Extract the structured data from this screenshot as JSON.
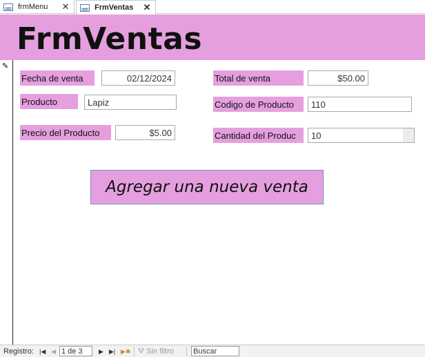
{
  "tabs": [
    {
      "label": "frmMenu",
      "close": "✕"
    },
    {
      "label": "FrmVentas",
      "close": "✕"
    }
  ],
  "form": {
    "title": "FrmVentas",
    "fields": {
      "fecha_label": "Fecha de venta",
      "fecha_value": "02/12/2024",
      "producto_label": "Producto",
      "producto_value": "Lapiz",
      "precio_label": "Precio del Producto",
      "precio_value": "$5.00",
      "total_label": "Total de venta",
      "total_value": "$50.00",
      "codigo_label": "Codigo de Producto",
      "codigo_value": "110",
      "cantidad_label": "Cantidad del Produc",
      "cantidad_value": "10"
    },
    "add_button": "Agregar una nueva venta"
  },
  "nav": {
    "records_label": "Registro:",
    "position": "1 de 3",
    "filter_label": "Sin filtro",
    "search_label": "Buscar",
    "icons": [
      "first-record-icon",
      "previous-record-icon",
      "next-record-icon",
      "last-record-icon",
      "new-record-icon",
      "filter-icon"
    ]
  }
}
